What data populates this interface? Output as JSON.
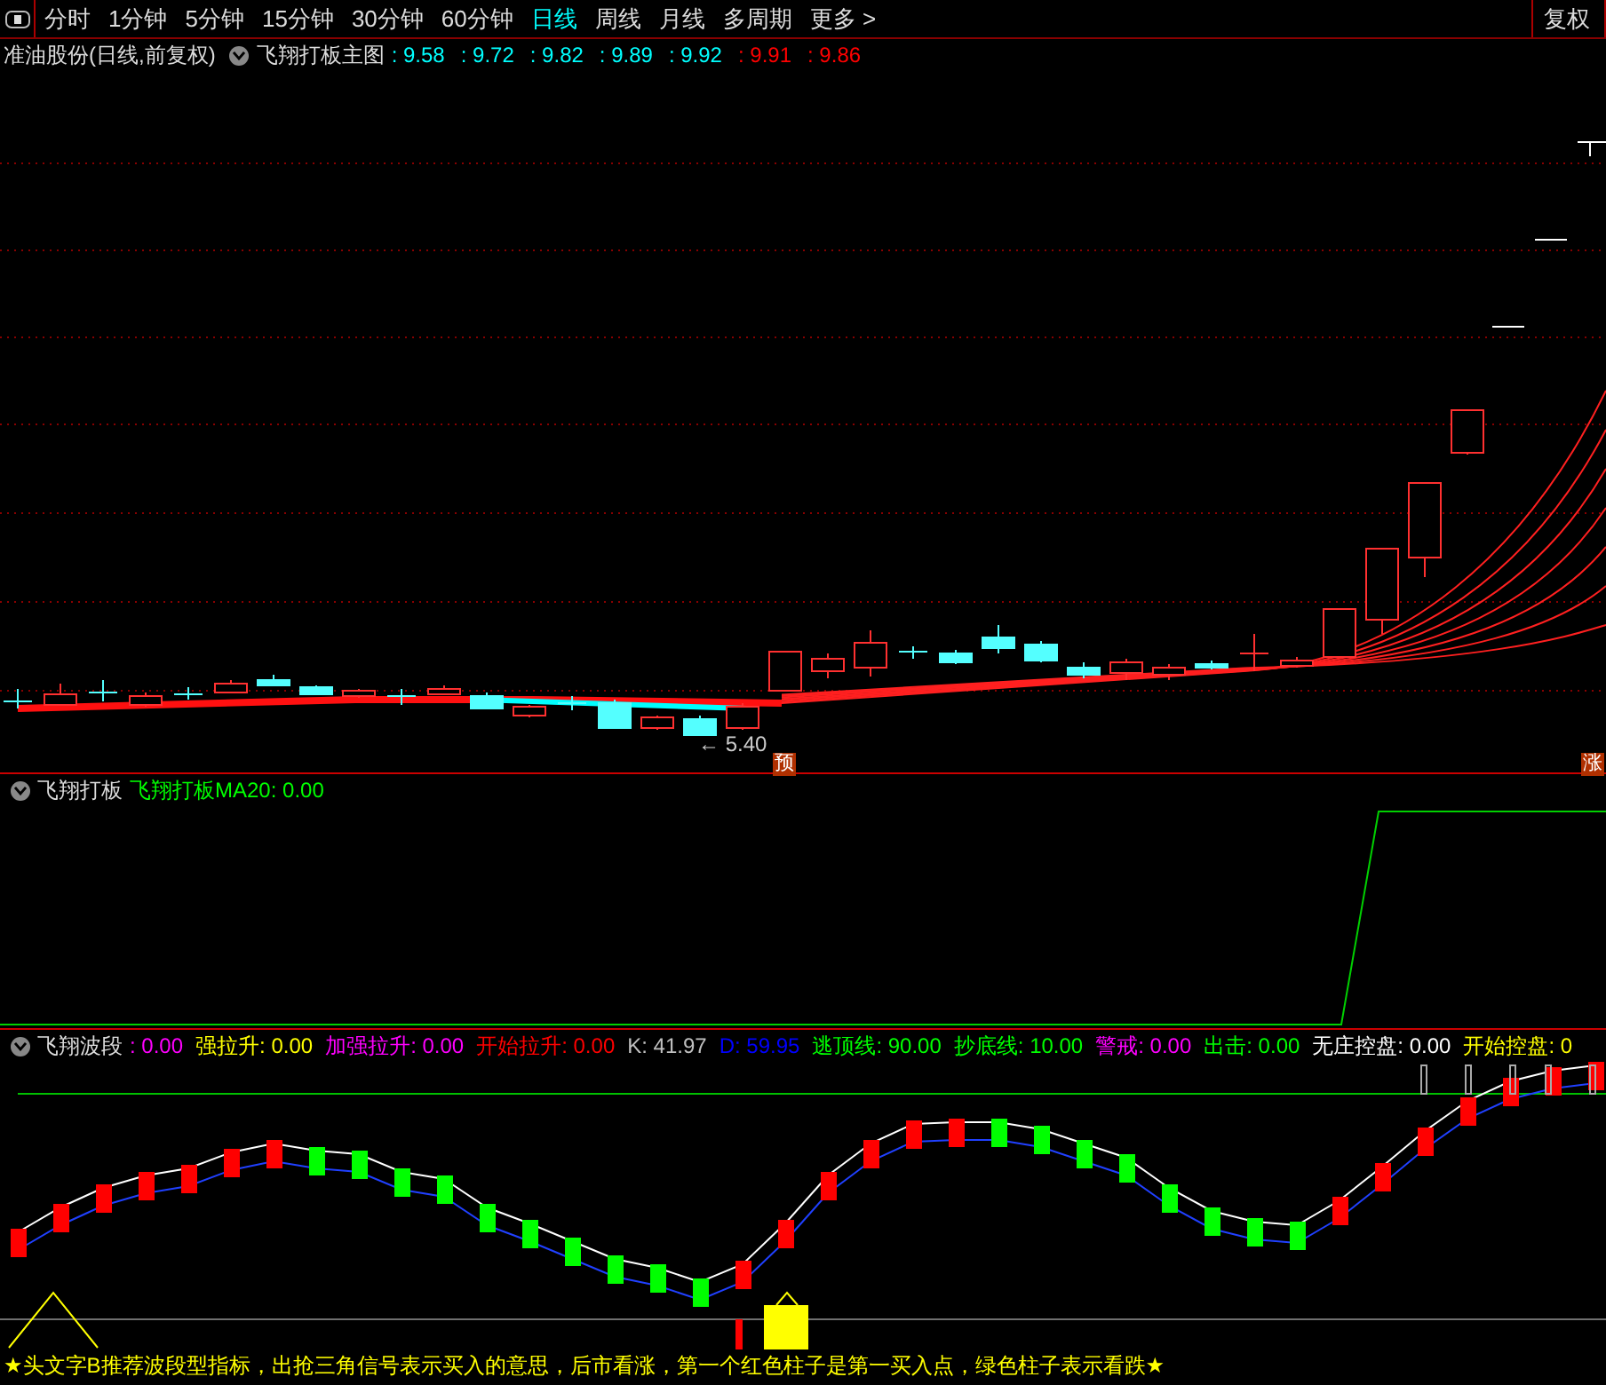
{
  "toolbar": {
    "periods": [
      {
        "label": "分时",
        "selected": false
      },
      {
        "label": "1分钟",
        "selected": false
      },
      {
        "label": "5分钟",
        "selected": false
      },
      {
        "label": "15分钟",
        "selected": false
      },
      {
        "label": "30分钟",
        "selected": false
      },
      {
        "label": "60分钟",
        "selected": false
      },
      {
        "label": "日线",
        "selected": true
      },
      {
        "label": "周线",
        "selected": false
      },
      {
        "label": "月线",
        "selected": false
      },
      {
        "label": "多周期",
        "selected": false
      }
    ],
    "more": "更多 >",
    "right_button": "复权"
  },
  "main_panel": {
    "stock_title": "准油股份(日线,前复权)",
    "indicator": "飞翔打板主图",
    "values": [
      {
        "text": ": 9.58",
        "color": "#00ffff"
      },
      {
        "text": ": 9.72",
        "color": "#00ffff"
      },
      {
        "text": ": 9.82",
        "color": "#00ffff"
      },
      {
        "text": ": 9.89",
        "color": "#00ffff"
      },
      {
        "text": ": 9.92",
        "color": "#00ffff"
      },
      {
        "text": ": 9.91",
        "color": "#ff0000"
      },
      {
        "text": ": 9.86",
        "color": "#ff0000"
      }
    ],
    "low_label": "← 5.40",
    "markers": [
      "预",
      "涨"
    ]
  },
  "panel_2": {
    "name": "飞翔打板",
    "values": [
      {
        "text": "飞翔打板MA20: 0.00",
        "color": "#00ff00"
      }
    ]
  },
  "panel_3": {
    "name": "飞翔波段",
    "values": [
      {
        "text": ": 0.00",
        "color": "#ff00ff"
      },
      {
        "text": "强拉升: 0.00",
        "color": "#ffff00"
      },
      {
        "text": "加强拉升: 0.00",
        "color": "#ff00ff"
      },
      {
        "text": "开始拉升: 0.00",
        "color": "#ff0000"
      },
      {
        "text": "K: 41.97",
        "color": "#c0c0c0"
      },
      {
        "text": "D: 59.95",
        "color": "#0000ff"
      },
      {
        "text": "逃顶线: 90.00",
        "color": "#00ff00"
      },
      {
        "text": "抄底线: 10.00",
        "color": "#00ff00"
      },
      {
        "text": "警戒: 0.00",
        "color": "#ff00ff"
      },
      {
        "text": "出击: 0.00",
        "color": "#00ff00"
      },
      {
        "text": "无庄控盘: 0.00",
        "color": "#ffffff"
      },
      {
        "text": "开始控盘: 0",
        "color": "#ffff00"
      }
    ]
  },
  "footer": "★头文字B推荐波段型指标，出抢三角信号表示买入的意思，后市看涨，第一个红色柱子是第一买入点，绿色柱子表示看跌★"
}
